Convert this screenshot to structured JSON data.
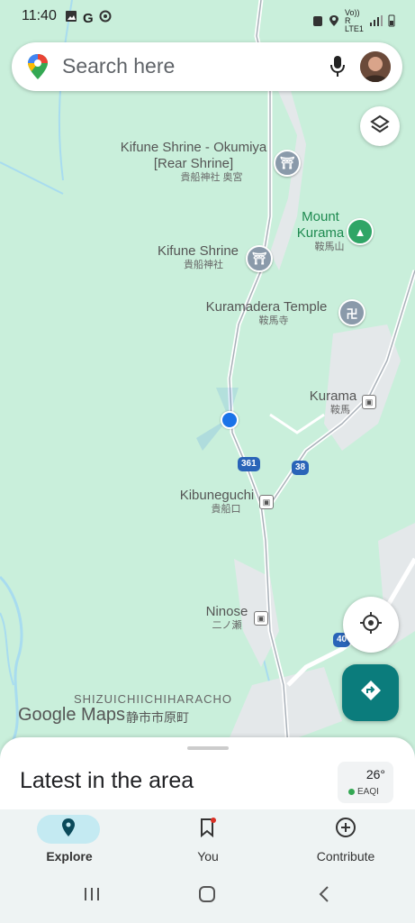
{
  "status_bar": {
    "time": "11:40",
    "network_label": "Vo)) R LTE1"
  },
  "search": {
    "placeholder": "Search here"
  },
  "map": {
    "places": [
      {
        "name": "Kifune Shrine - Okumiya [Rear Shrine]",
        "jp": "貴船神社 奥宮"
      },
      {
        "name": "Mount Kurama",
        "jp": "鞍馬山"
      },
      {
        "name": "Kifune Shrine",
        "jp": "貴船神社"
      },
      {
        "name": "Kuramadera Temple",
        "jp": "鞍馬寺"
      },
      {
        "name": "Kurama",
        "jp": "鞍馬"
      },
      {
        "name": "Kibuneguchi",
        "jp": "貴船口"
      },
      {
        "name": "Ninose",
        "jp": "二ノ瀬"
      }
    ],
    "route_shields": [
      "361",
      "38",
      "40"
    ],
    "area_label": "SHIZUICHIICHIHARACHO",
    "area_label_jp": "静市市原町",
    "logo_text": "Google Maps"
  },
  "sheet": {
    "title": "Latest in the area"
  },
  "weather": {
    "temp": "26°",
    "aqi_label": "EAQI"
  },
  "nav": {
    "items": [
      {
        "label": "Explore"
      },
      {
        "label": "You"
      },
      {
        "label": "Contribute"
      }
    ]
  },
  "colors": {
    "accent": "#0b7c7c",
    "location": "#1a73e8",
    "map_bg": "#c9efdb"
  }
}
